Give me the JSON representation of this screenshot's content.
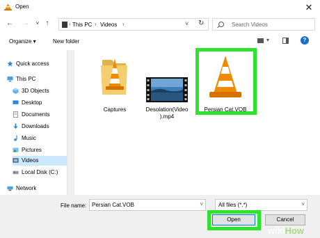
{
  "window": {
    "title": "Open",
    "close_glyph": "✕"
  },
  "nav": {
    "back": "←",
    "forward": "→",
    "recent": "˅",
    "up": "↑"
  },
  "address": {
    "crumbs": [
      "This PC",
      "Videos"
    ],
    "sep": "›",
    "dropdown": "˅",
    "refresh": "↻"
  },
  "search": {
    "placeholder": "Search Videos"
  },
  "toolbar": {
    "organize": "Organize ▾",
    "new_folder": "New folder",
    "help": "?",
    "dd": "▾"
  },
  "sidebar": {
    "items": [
      {
        "label": "Quick access",
        "icon": "star-icon"
      },
      {
        "label": "This PC",
        "icon": "computer-icon"
      },
      {
        "label": "3D Objects",
        "icon": "cube-icon"
      },
      {
        "label": "Desktop",
        "icon": "desktop-icon"
      },
      {
        "label": "Documents",
        "icon": "document-icon"
      },
      {
        "label": "Downloads",
        "icon": "download-icon"
      },
      {
        "label": "Music",
        "icon": "music-icon"
      },
      {
        "label": "Pictures",
        "icon": "picture-icon"
      },
      {
        "label": "Videos",
        "icon": "video-icon"
      },
      {
        "label": "Local Disk (C:)",
        "icon": "disk-icon"
      },
      {
        "label": "Network",
        "icon": "network-icon"
      }
    ]
  },
  "files": [
    {
      "name": "Captures",
      "type": "folder-vlc"
    },
    {
      "name": "Desolation(Video).mp4",
      "line1": "Desolation(Video",
      "line2": ").mp4",
      "type": "video-thumbnail"
    },
    {
      "name": "Persian Cat.VOB",
      "type": "vlc-file",
      "selected": true
    }
  ],
  "bottom": {
    "file_name_label": "File name:",
    "file_name_value": "Persian Cat.VOB",
    "filter_value": "All files (*.*)",
    "open_label": "Open",
    "cancel_label": "Cancel",
    "dd": "˅"
  },
  "watermark": {
    "prefix": "wiki",
    "suffix": "How"
  },
  "colors": {
    "highlight": "#2ee32e",
    "selection": "#cce8ff",
    "accent": "#0078d7",
    "vlc_orange": "#f08a00"
  }
}
